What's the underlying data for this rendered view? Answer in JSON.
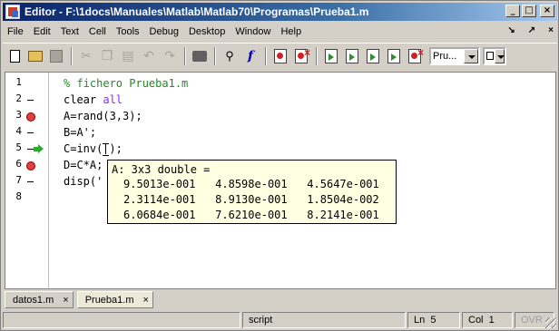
{
  "window": {
    "title": "Editor - F:\\1docs\\Manuales\\Matlab\\Matlab70\\Programas\\Prueba1.m",
    "buttons": {
      "minimize": "_",
      "maximize": "□",
      "close": "×"
    }
  },
  "menu": {
    "items": [
      "File",
      "Edit",
      "Text",
      "Cell",
      "Tools",
      "Debug",
      "Desktop",
      "Window",
      "Help"
    ],
    "right": {
      "dock_arrow": "↘",
      "undock_arrow": "↗",
      "close": "×"
    }
  },
  "toolbar": {
    "stack_value": "Pru...",
    "icons": [
      "new-file-icon",
      "open-folder-icon",
      "save-icon",
      "cut-icon",
      "copy-icon",
      "paste-icon",
      "undo-icon",
      "redo-icon",
      "print-icon",
      "find-icon",
      "function-icon",
      "set-breakpoint-icon",
      "clear-breakpoints-icon",
      "step-icon",
      "step-in-icon",
      "step-out-icon",
      "continue-icon",
      "exit-debug-icon"
    ]
  },
  "editor": {
    "lines": [
      {
        "num": "1",
        "marker": "none",
        "text": "% fichero Prueba1.m"
      },
      {
        "num": "2",
        "marker": "dash",
        "text_pre": "clear ",
        "text_kw": "all"
      },
      {
        "num": "3",
        "marker": "breakpoint",
        "text": "A=rand(3,3);"
      },
      {
        "num": "4",
        "marker": "dash",
        "text": "B=A';"
      },
      {
        "num": "5",
        "marker": "dash-arrow",
        "text_pre": "C=inv(",
        "text_post": ");"
      },
      {
        "num": "6",
        "marker": "breakpoint",
        "text": "D=C*A;"
      },
      {
        "num": "7",
        "marker": "dash",
        "text": "disp('"
      },
      {
        "num": "8",
        "marker": "none",
        "text": ""
      }
    ]
  },
  "datatip": {
    "header": "A: 3x3 double =",
    "rows": [
      "9.5013e-001   4.8598e-001   4.5647e-001",
      "2.3114e-001   8.9130e-001   1.8504e-002",
      "6.0684e-001   7.6210e-001   8.2141e-001"
    ]
  },
  "tabs": [
    {
      "label": "datos1.m",
      "close": "×"
    },
    {
      "label": "Prueba1.m",
      "close": "×"
    }
  ],
  "status": {
    "mode": "script",
    "line_label": "Ln",
    "line": "5",
    "col_label": "Col",
    "col": "1",
    "ovr": "OVR"
  },
  "colors": {
    "comment": "#228b22",
    "keyword": "#0000ff",
    "breakpoint": "#e04040",
    "execution_arrow": "#2ea82e",
    "datatip_bg": "#ffffe1"
  }
}
